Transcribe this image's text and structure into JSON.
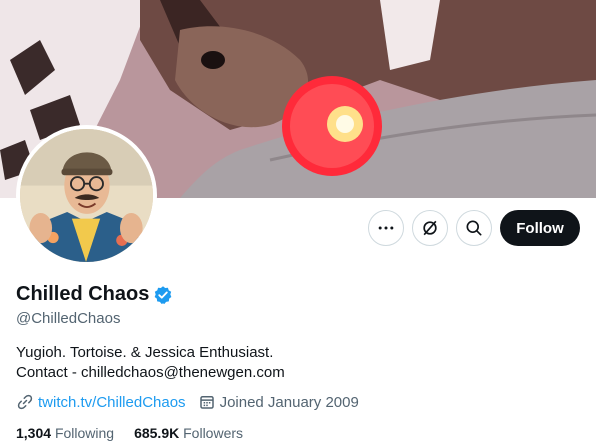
{
  "profile": {
    "display_name": "Chilled Chaos",
    "handle": "@ChilledChaos",
    "bio_line1": "Yugioh. Tortoise. & Jessica Enthusiast.",
    "bio_line2": "Contact - chilledchaos@thenewgen.com",
    "website": "twitch.tv/ChilledChaos",
    "joined": "Joined January 2009",
    "following_count": "1,304",
    "following_label": "Following",
    "followers_count": "685.9K",
    "followers_label": "Followers",
    "verified": true
  },
  "actions": {
    "more_icon": "more-horizontal-icon",
    "grok_icon": "grok-icon",
    "search_icon": "search-icon",
    "follow_label": "Follow"
  },
  "colors": {
    "accent": "#1d9bf0",
    "text_primary": "#0f1419",
    "text_secondary": "#536471",
    "follow_bg": "#0f1419"
  }
}
